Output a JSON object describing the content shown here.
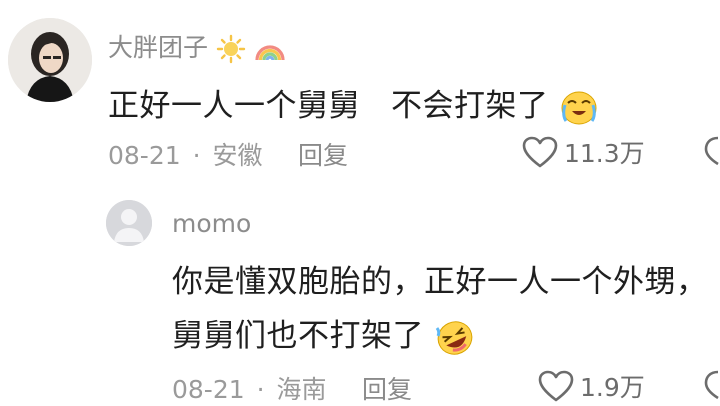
{
  "comments": [
    {
      "author": "大胖团子",
      "author_icons": [
        "sun-emoji-icon",
        "rainbow-emoji-icon"
      ],
      "text": "正好一人一个舅舅   不会打架了",
      "trailing_emoji": "crying-face-emoji-icon",
      "date": "08-21",
      "separator": "·",
      "location": "安徽",
      "reply_label": "回复",
      "like_count": "11.3万"
    },
    {
      "author": "momo",
      "text_line1": "你是懂双胞胎的，正好一人一个外甥，",
      "text_line2": "舅舅们也不打架了",
      "trailing_emoji": "rolling-laughing-emoji-icon",
      "date": "08-21",
      "separator": "·",
      "location": "海南",
      "reply_label": "回复",
      "like_count": "1.9万"
    }
  ]
}
